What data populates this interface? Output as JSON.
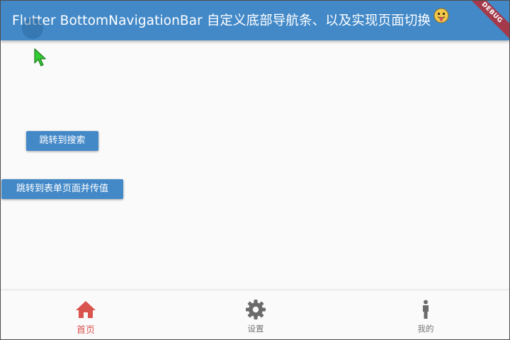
{
  "appbar": {
    "title": "Flutter BottomNavigationBar 自定义底部导航条、以及实现页面切换"
  },
  "debug_banner": "DEBUG",
  "buttons": {
    "search": "跳转到搜索",
    "form": "跳转到表单页面并传值"
  },
  "bottom_nav": {
    "items": [
      {
        "label": "首页",
        "icon": "home-icon",
        "active": true
      },
      {
        "label": "设置",
        "icon": "settings-icon",
        "active": false
      },
      {
        "label": "我的",
        "icon": "person-icon",
        "active": false
      }
    ],
    "active_color": "#d9534f",
    "inactive_color": "#757575"
  },
  "colors": {
    "appbar": "#4389c8",
    "button": "#4389c8",
    "background": "#fafafa",
    "debug_banner": "#a4394a"
  }
}
